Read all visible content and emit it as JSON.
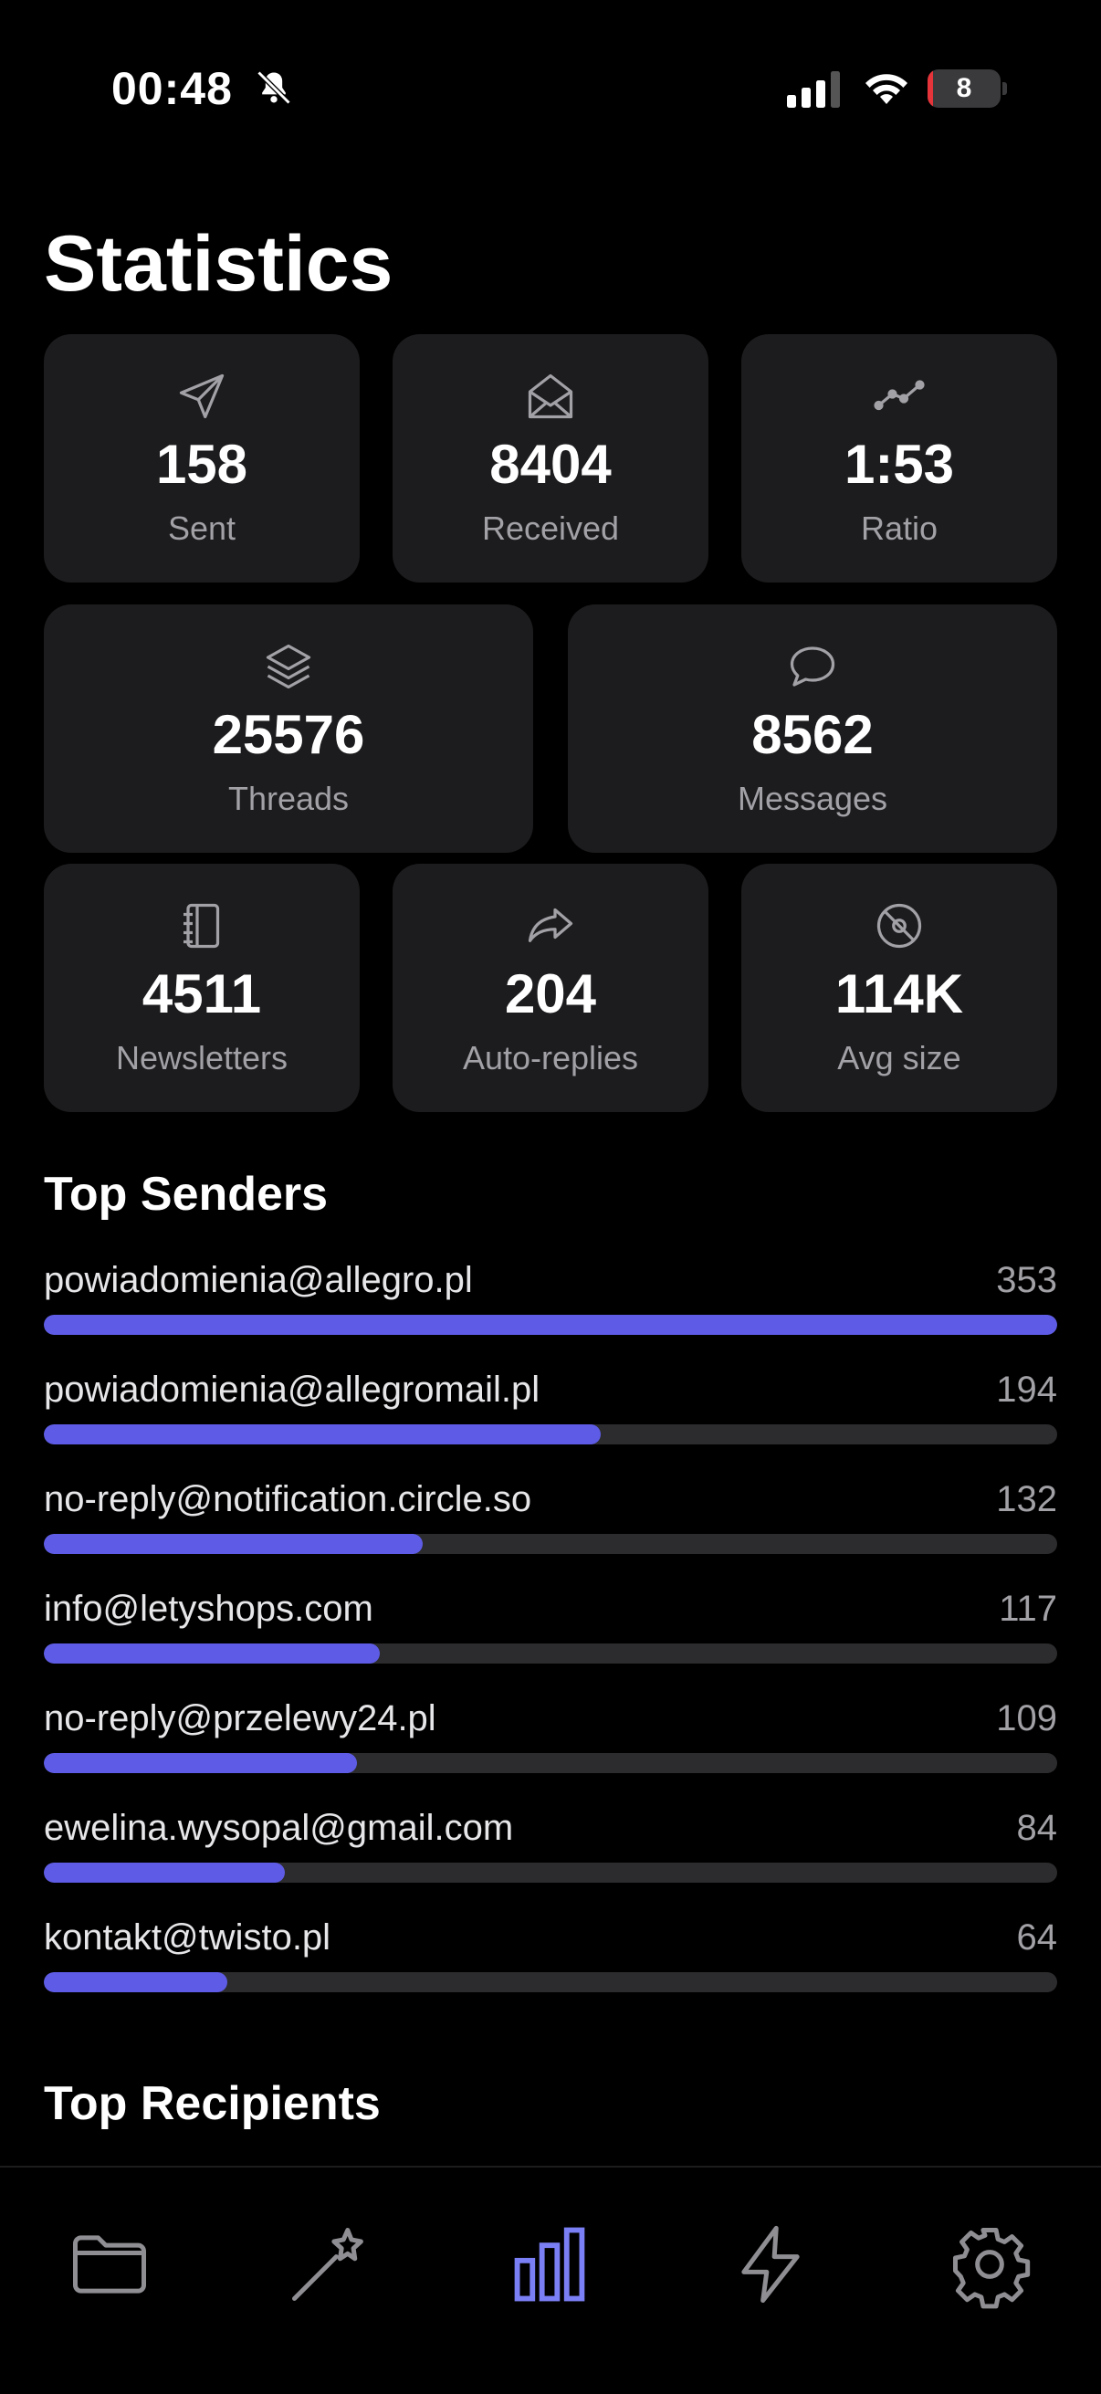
{
  "status_bar": {
    "time": "00:48",
    "battery_level": "8",
    "battery_fraction": 0.08,
    "icons": [
      "bell-slash-icon",
      "signal-icon",
      "wifi-icon",
      "battery-icon"
    ]
  },
  "page_title": "Statistics",
  "stats": {
    "sent": {
      "value": "158",
      "label": "Sent",
      "icon": "paper-plane-icon"
    },
    "received": {
      "value": "8404",
      "label": "Received",
      "icon": "envelope-open-icon"
    },
    "ratio": {
      "value": "1:53",
      "label": "Ratio",
      "icon": "line-chart-icon"
    },
    "threads": {
      "value": "25576",
      "label": "Threads",
      "icon": "layers-icon"
    },
    "messages": {
      "value": "8562",
      "label": "Messages",
      "icon": "chat-bubble-icon"
    },
    "newsletters": {
      "value": "4511",
      "label": "Newsletters",
      "icon": "notebook-icon"
    },
    "auto_replies": {
      "value": "204",
      "label": "Auto-replies",
      "icon": "forward-arrow-icon"
    },
    "avg_size": {
      "value": "114K",
      "label": "Avg size",
      "icon": "disc-icon"
    }
  },
  "top_senders": {
    "title": "Top Senders",
    "items": [
      {
        "email": "powiadomienia@allegro.pl",
        "count": 353
      },
      {
        "email": "powiadomienia@allegromail.pl",
        "count": 194
      },
      {
        "email": "no-reply@notification.circle.so",
        "count": 132
      },
      {
        "email": "info@letyshops.com",
        "count": 117
      },
      {
        "email": "no-reply@przelewy24.pl",
        "count": 109
      },
      {
        "email": "ewelina.wysopal@gmail.com",
        "count": 84
      },
      {
        "email": "kontakt@twisto.pl",
        "count": 64
      }
    ]
  },
  "top_recipients": {
    "title": "Top Recipients"
  },
  "tab_bar": {
    "tabs": [
      {
        "icon": "folder-icon",
        "active": false
      },
      {
        "icon": "magic-wand-icon",
        "active": false
      },
      {
        "icon": "bar-chart-icon",
        "active": true
      },
      {
        "icon": "lightning-icon",
        "active": false
      },
      {
        "icon": "gear-icon",
        "active": false
      }
    ]
  },
  "colors": {
    "accent": "#5e5ce6",
    "tab_active": "#7b7ff5",
    "tab_inactive": "#8e8e93",
    "card_bg": "#1c1c1e",
    "bar_track": "#2c2c2e",
    "battery_low": "#e5343a"
  }
}
